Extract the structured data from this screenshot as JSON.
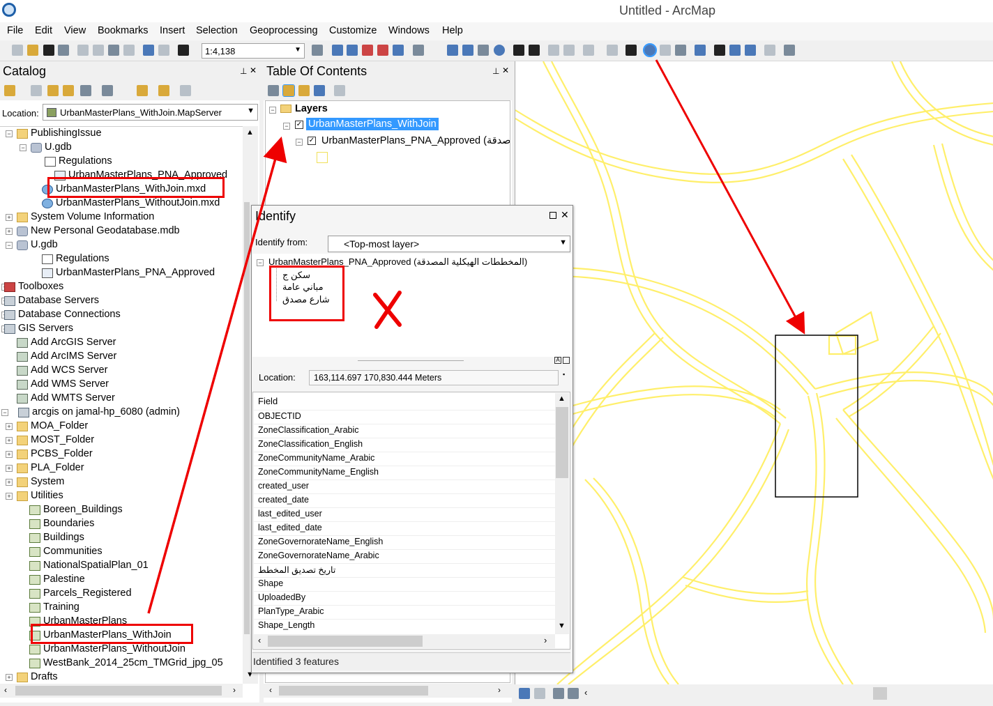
{
  "window": {
    "title": "Untitled - ArcMap"
  },
  "menu": [
    "File",
    "Edit",
    "View",
    "Bookmarks",
    "Insert",
    "Selection",
    "Geoprocessing",
    "Customize",
    "Windows",
    "Help"
  ],
  "toolbar": {
    "scale": "1:4,138"
  },
  "catalog": {
    "title": "Catalog",
    "location_label": "Location:",
    "location_value": "UrbanMasterPlans_WithJoin.MapServer",
    "tree": [
      {
        "label": "PublishingIssue",
        "icon": "folder-icon",
        "expander": "−"
      },
      {
        "label": "U.gdb",
        "icon": "geodatabase-icon",
        "expander": "−"
      },
      {
        "label": "Regulations",
        "icon": "table-icon",
        "expander": ""
      },
      {
        "label": "UrbanMasterPlans_PNA_Approved",
        "icon": "feature-class-icon",
        "expander": ""
      },
      {
        "label": "UrbanMasterPlans_WithJoin.mxd",
        "icon": "map-document-icon",
        "expander": ""
      },
      {
        "label": "UrbanMasterPlans_WithoutJoin.mxd",
        "icon": "map-document-icon",
        "expander": ""
      },
      {
        "label": "System Volume Information",
        "icon": "folder-icon",
        "expander": "+"
      },
      {
        "label": "New Personal Geodatabase.mdb",
        "icon": "geodatabase-icon",
        "expander": "+"
      },
      {
        "label": "U.gdb",
        "icon": "geodatabase-icon",
        "expander": "−"
      },
      {
        "label": "Regulations",
        "icon": "table-icon",
        "expander": ""
      },
      {
        "label": "UrbanMasterPlans_PNA_Approved",
        "icon": "feature-class-icon",
        "expander": ""
      },
      {
        "label": "Toolboxes",
        "icon": "toolbox-icon",
        "expander": "+"
      },
      {
        "label": "Database Servers",
        "icon": "server-icon",
        "expander": "+"
      },
      {
        "label": "Database Connections",
        "icon": "server-icon",
        "expander": "+"
      },
      {
        "label": "GIS Servers",
        "icon": "server-icon",
        "expander": "−"
      },
      {
        "label": "Add ArcGIS Server",
        "icon": "add-server-icon",
        "expander": ""
      },
      {
        "label": "Add ArcIMS Server",
        "icon": "add-server-icon",
        "expander": ""
      },
      {
        "label": "Add WCS Server",
        "icon": "add-server-icon",
        "expander": ""
      },
      {
        "label": "Add WMS Server",
        "icon": "add-server-icon",
        "expander": ""
      },
      {
        "label": "Add WMTS Server",
        "icon": "add-server-icon",
        "expander": ""
      },
      {
        "label": "arcgis on jamal-hp_6080 (admin)",
        "icon": "server-icon",
        "expander": "−"
      },
      {
        "label": "MOA_Folder",
        "icon": "folder-icon",
        "expander": "+"
      },
      {
        "label": "MOST_Folder",
        "icon": "folder-icon",
        "expander": "+"
      },
      {
        "label": "PCBS_Folder",
        "icon": "folder-icon",
        "expander": "+"
      },
      {
        "label": "PLA_Folder",
        "icon": "folder-icon",
        "expander": "+"
      },
      {
        "label": "System",
        "icon": "folder-icon",
        "expander": "+"
      },
      {
        "label": "Utilities",
        "icon": "folder-icon",
        "expander": "+"
      },
      {
        "label": "Boreen_Buildings",
        "icon": "map-service-icon",
        "expander": ""
      },
      {
        "label": "Boundaries",
        "icon": "map-service-icon",
        "expander": ""
      },
      {
        "label": "Buildings",
        "icon": "map-service-icon",
        "expander": ""
      },
      {
        "label": "Communities",
        "icon": "map-service-icon",
        "expander": ""
      },
      {
        "label": "NationalSpatialPlan_01",
        "icon": "map-service-icon",
        "expander": ""
      },
      {
        "label": "Palestine",
        "icon": "map-service-icon",
        "expander": ""
      },
      {
        "label": "Parcels_Registered",
        "icon": "map-service-icon",
        "expander": ""
      },
      {
        "label": "Training",
        "icon": "map-service-icon",
        "expander": ""
      },
      {
        "label": "UrbanMasterPlans",
        "icon": "map-service-icon",
        "expander": ""
      },
      {
        "label": "UrbanMasterPlans_WithJoin",
        "icon": "map-service-icon",
        "expander": ""
      },
      {
        "label": "UrbanMasterPlans_WithoutJoin",
        "icon": "map-service-icon",
        "expander": ""
      },
      {
        "label": "WestBank_2014_25cm_TMGrid_jpg_05",
        "icon": "map-service-icon",
        "expander": ""
      },
      {
        "label": "Drafts",
        "icon": "folder-icon",
        "expander": "+"
      }
    ]
  },
  "toc": {
    "title": "Table Of Contents",
    "layers_label": "Layers",
    "group_layer": "UrbanMasterPlans_WithJoin",
    "sub_layer": "UrbanMasterPlans_PNA_Approved (صدقة"
  },
  "identify": {
    "title": "Identify",
    "from_label": "Identify from:",
    "from_value": "<Top-most layer>",
    "layer_node": "UrbanMasterPlans_PNA_Approved (المخططات الهيكلية المصدقة)",
    "features": [
      "سكن ج",
      "مباني عامة",
      "شارع مصدق"
    ],
    "location_label": "Location:",
    "location_value": "163,114.697  170,830.444 Meters",
    "field_header": "Field",
    "fields": [
      "OBJECTID",
      "ZoneClassification_Arabic",
      "ZoneClassification_English",
      "ZoneCommunityName_Arabic",
      "ZoneCommunityName_English",
      "created_user",
      "created_date",
      "last_edited_user",
      "last_edited_date",
      "ZoneGovernorateName_English",
      "ZoneGovernorateName_Arabic",
      "تاريخ تصديق المخطط",
      "Shape",
      "UploadedBy",
      "PlanType_Arabic",
      "Shape_Length"
    ],
    "status": "Identified 3 features"
  },
  "colors": {
    "accent": "#3399ff",
    "annotation": "#e00000",
    "map_lines": "#ffef6a"
  }
}
